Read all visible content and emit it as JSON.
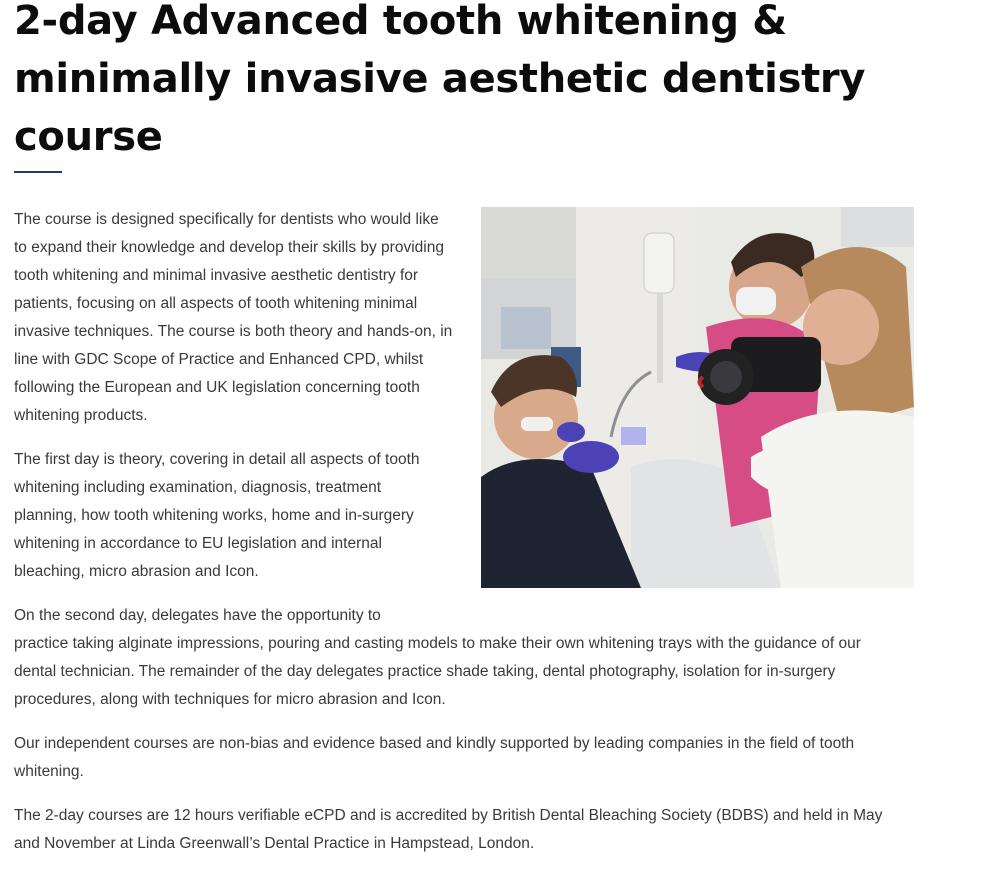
{
  "page": {
    "title": "2-day Advanced tooth whitening & minimally invasive aesthetic dentistry course"
  },
  "content": {
    "paragraph_1": "The course is designed specifically for dentists who would like to expand their knowledge and develop their skills by providing tooth whitening and minimal invasive aesthetic dentistry for patients, focusing on all aspects of tooth whitening minimal invasive techniques. The course is both theory and hands-on, in line with GDC Scope of Practice and Enhanced CPD, whilst following the European and UK legislation concerning tooth whitening products.",
    "paragraph_2": "The first day is theory, covering in detail all aspects of tooth whitening including examination, diagnosis, treatment planning, how tooth whitening works, home and in-surgery whitening in accordance to EU legislation and internal bleaching, micro abrasion and Icon.",
    "paragraph_3_line_1": "On the second day, delegates have the opportunity to",
    "paragraph_3_rest": "practice taking alginate impressions, pouring and casting models to make their own whitening trays with the guidance of our dental technician. The remainder of the day delegates practice shade taking, dental photography, isolation for in-surgery procedures, along with techniques for micro abrasion and Icon.",
    "paragraph_4": "Our independent courses are non-bias and evidence based and kindly supported by leading companies in the field of tooth whitening.",
    "paragraph_5": "The 2-day courses are 12 hours verifiable eCPD and is accredited by British Dental Bleaching Society (BDBS) and held in May and November at Linda Greenwall’s Dental Practice in Hampstead, London."
  },
  "theme": {
    "accent": "#1f3a6e",
    "heading_color": "#0c0c0c",
    "body_text_color": "#3a3a3a"
  }
}
